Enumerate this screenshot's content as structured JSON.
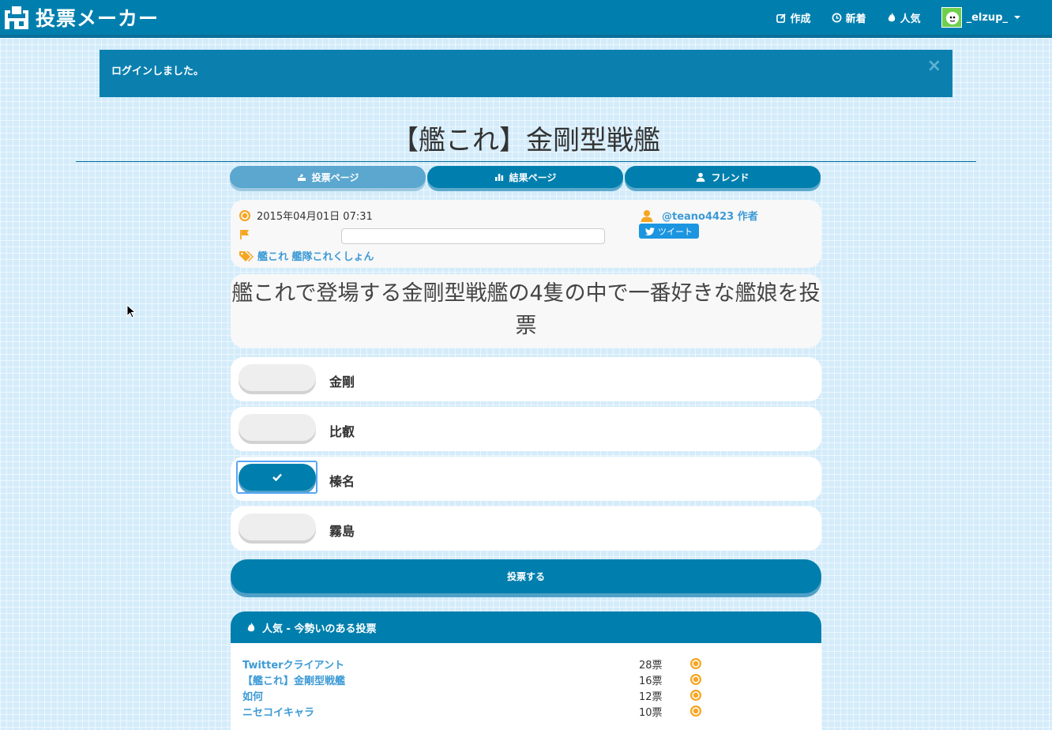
{
  "navbar": {
    "brand": "投票メーカー",
    "items": [
      {
        "label": "作成",
        "icon": "edit-icon"
      },
      {
        "label": "新着",
        "icon": "clock-icon"
      },
      {
        "label": "人気",
        "icon": "fire-icon"
      }
    ],
    "user": "_elzup_"
  },
  "alert": {
    "message": "ログインしました。",
    "close": "×"
  },
  "page": {
    "title": "【艦これ】金剛型戦艦"
  },
  "tabs": [
    {
      "label": "投票ページ",
      "icon": "vote-icon",
      "active": true
    },
    {
      "label": "結果ページ",
      "icon": "bar-chart-icon",
      "active": false
    },
    {
      "label": "フレンド",
      "icon": "user-icon",
      "active": false
    }
  ],
  "meta": {
    "date": "2015年04月01日 07:31",
    "tags": "艦これ 艦隊これくしょん",
    "author": "@teano4423 作者",
    "tweet": "ツイート"
  },
  "question": "艦これで登場する金剛型戦艦の4隻の中で一番好きな艦娘を投票",
  "options": [
    {
      "label": "金剛",
      "selected": false
    },
    {
      "label": "比叡",
      "selected": false
    },
    {
      "label": "榛名",
      "selected": true
    },
    {
      "label": "霧島",
      "selected": false
    }
  ],
  "vote_button": "投票する",
  "popular": {
    "heading": "人気 - 今勢いのある投票",
    "items": [
      {
        "title": "Twitterクライアント",
        "count": "28票"
      },
      {
        "title": "【艦これ】金剛型戦艦",
        "count": "16票"
      },
      {
        "title": "如何",
        "count": "12票"
      },
      {
        "title": "ニセコイキャラ",
        "count": "10票"
      }
    ]
  },
  "colors": {
    "primary": "#007fae",
    "link": "#3c9ad6",
    "accent": "#f5a623",
    "background": "#d4ecfa"
  }
}
